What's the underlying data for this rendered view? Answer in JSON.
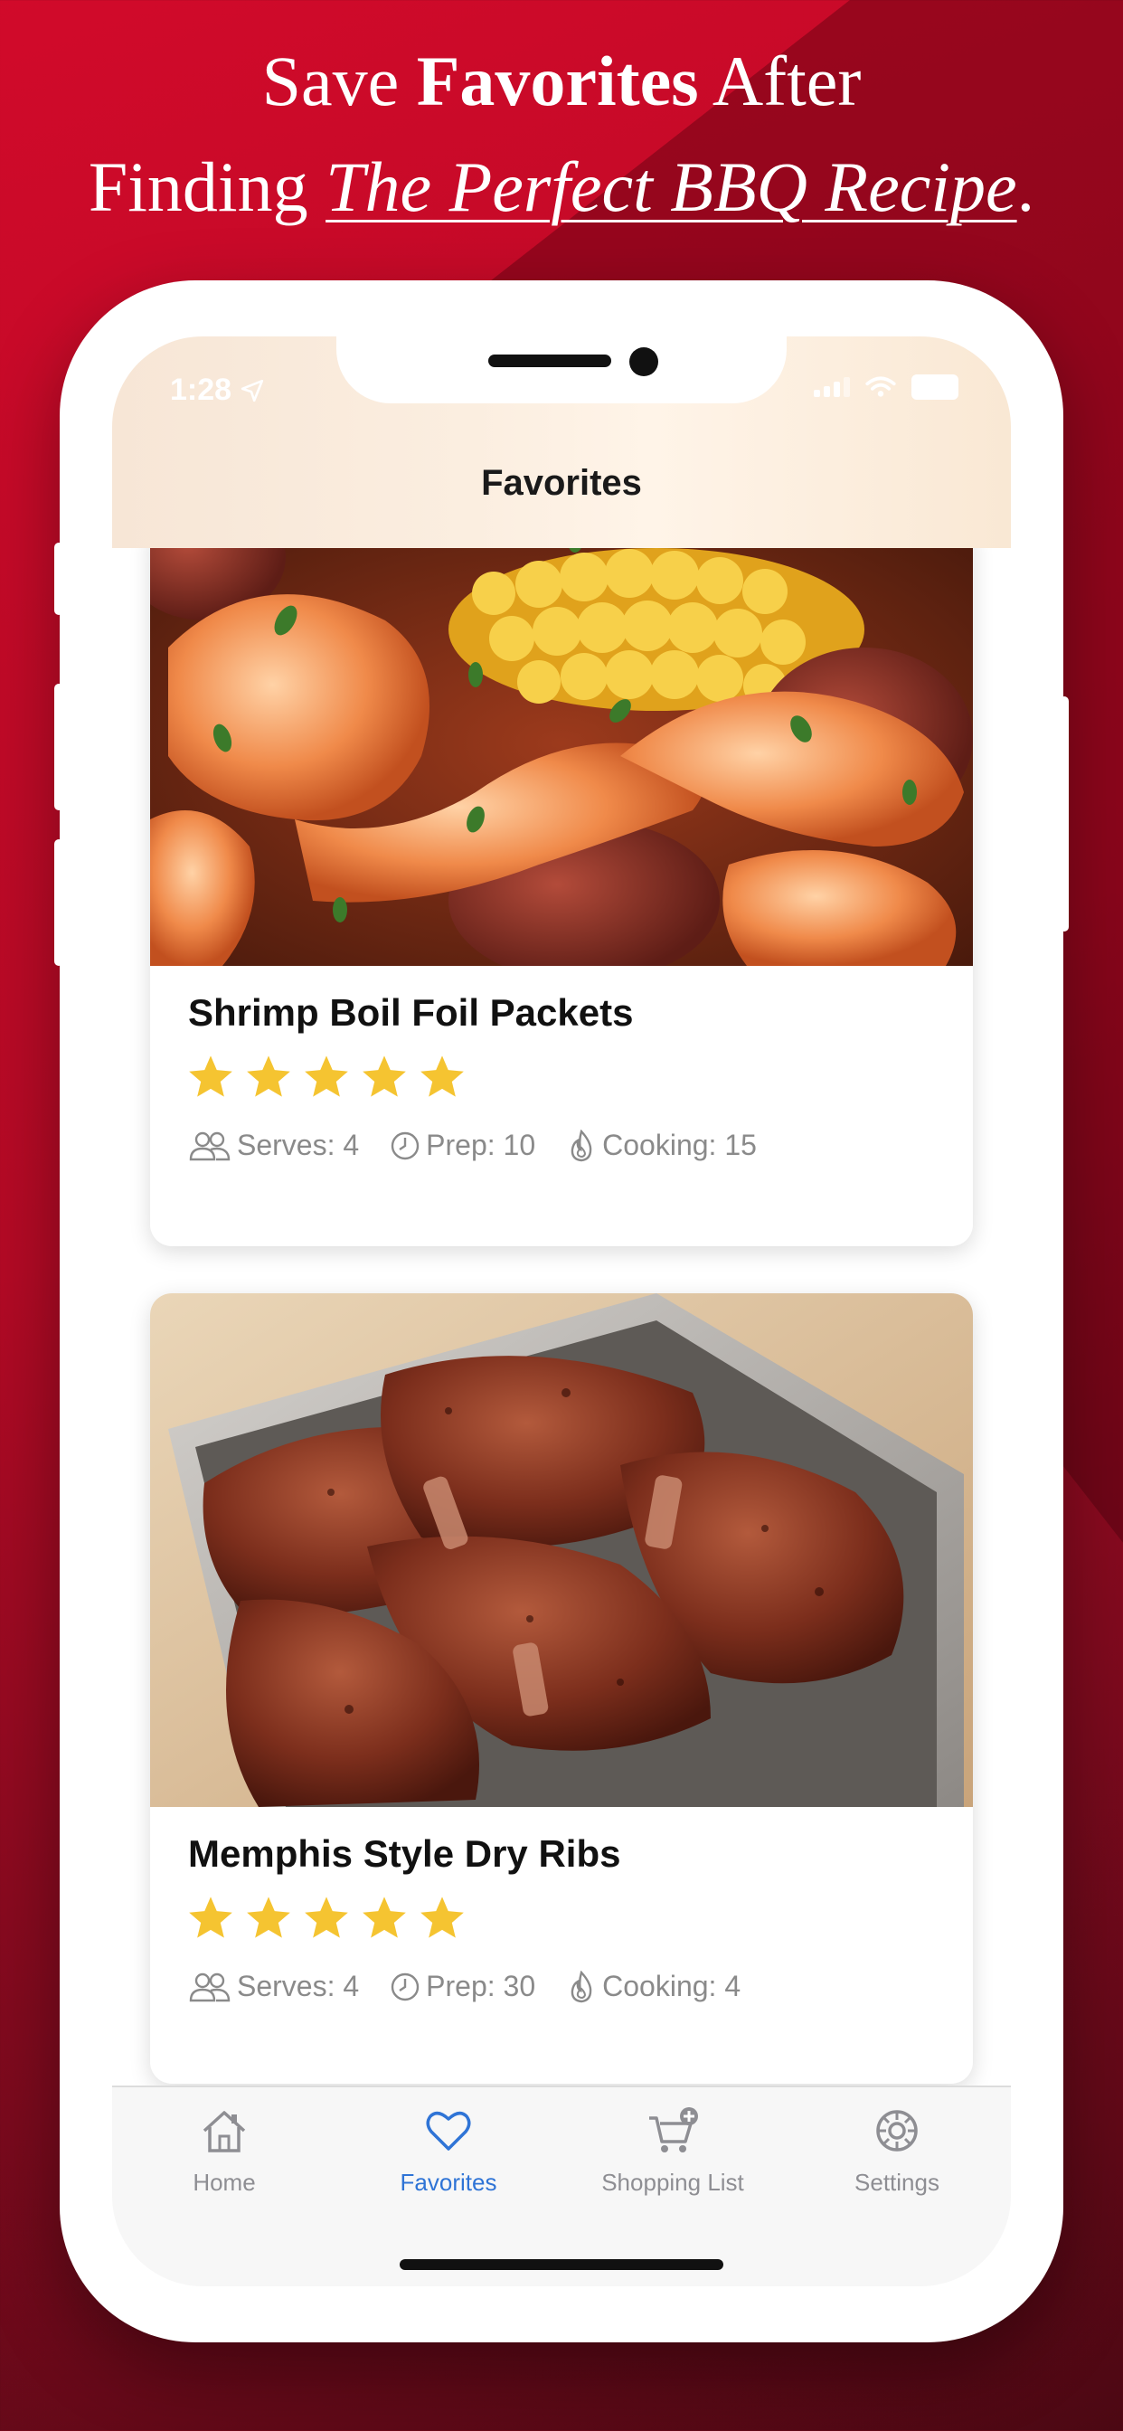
{
  "headline": {
    "line1_prefix": "Save ",
    "line1_bold": "Favorites",
    "line1_suffix": " After",
    "line2_prefix": "Finding ",
    "line2_underlined": "The Perfect BBQ Recipe",
    "line2_suffix": "."
  },
  "status_bar": {
    "time": "1:28"
  },
  "nav": {
    "title": "Favorites"
  },
  "recipes": [
    {
      "title": "Shrimp Boil Foil Packets",
      "rating": 5,
      "serves": "Serves: 4",
      "prep": "Prep: 10",
      "cooking": "Cooking: 15",
      "image": "shrimp-corn-sausage-photo"
    },
    {
      "title": "Memphis Style Dry Ribs",
      "rating": 5,
      "serves": "Serves: 4",
      "prep": "Prep: 30",
      "cooking": "Cooking: 4",
      "image": "dry-rubbed-ribs-photo"
    }
  ],
  "tabbar": {
    "items": [
      {
        "label": "Home",
        "icon": "house-icon",
        "active": false
      },
      {
        "label": "Favorites",
        "icon": "heart-icon",
        "active": true
      },
      {
        "label": "Shopping List",
        "icon": "cart-plus-icon",
        "active": false
      },
      {
        "label": "Settings",
        "icon": "gear-icon",
        "active": false
      }
    ]
  },
  "colors": {
    "background": "#c50a27",
    "accent": "#2f74d6",
    "star": "#f5c431",
    "meta_text": "#8a8a8a"
  }
}
